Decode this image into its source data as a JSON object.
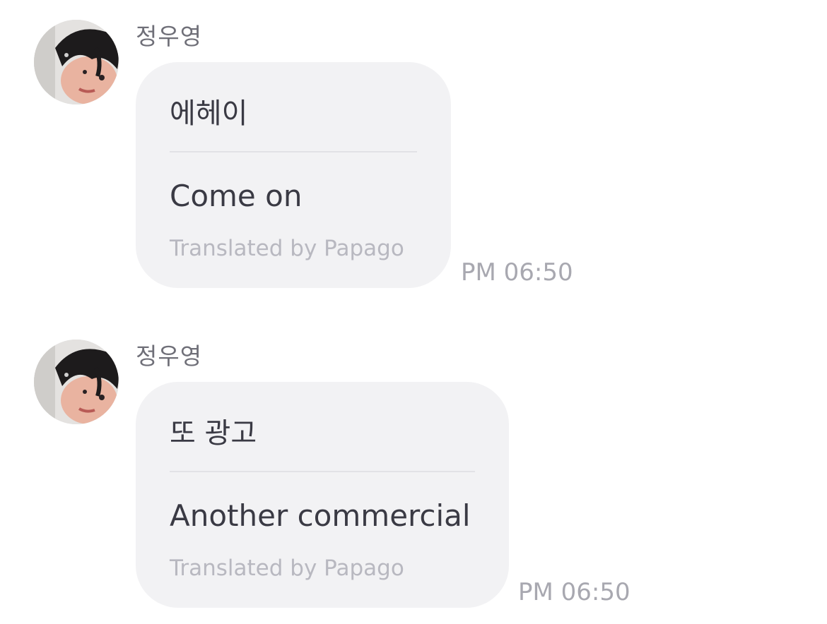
{
  "messages": [
    {
      "sender": "정우영",
      "original": "에헤이",
      "translation": "Come on",
      "credit": "Translated by Papago",
      "time": "PM 06:50"
    },
    {
      "sender": "정우영",
      "original": "또 광고",
      "translation": "Another commercial",
      "credit": "Translated by Papago",
      "time": "PM 06:50"
    }
  ],
  "colors": {
    "bubble": "#f2f2f4",
    "text": "#3a3a44",
    "meta": "#a8a8b0"
  },
  "icons": {
    "avatar": "profile-photo"
  }
}
